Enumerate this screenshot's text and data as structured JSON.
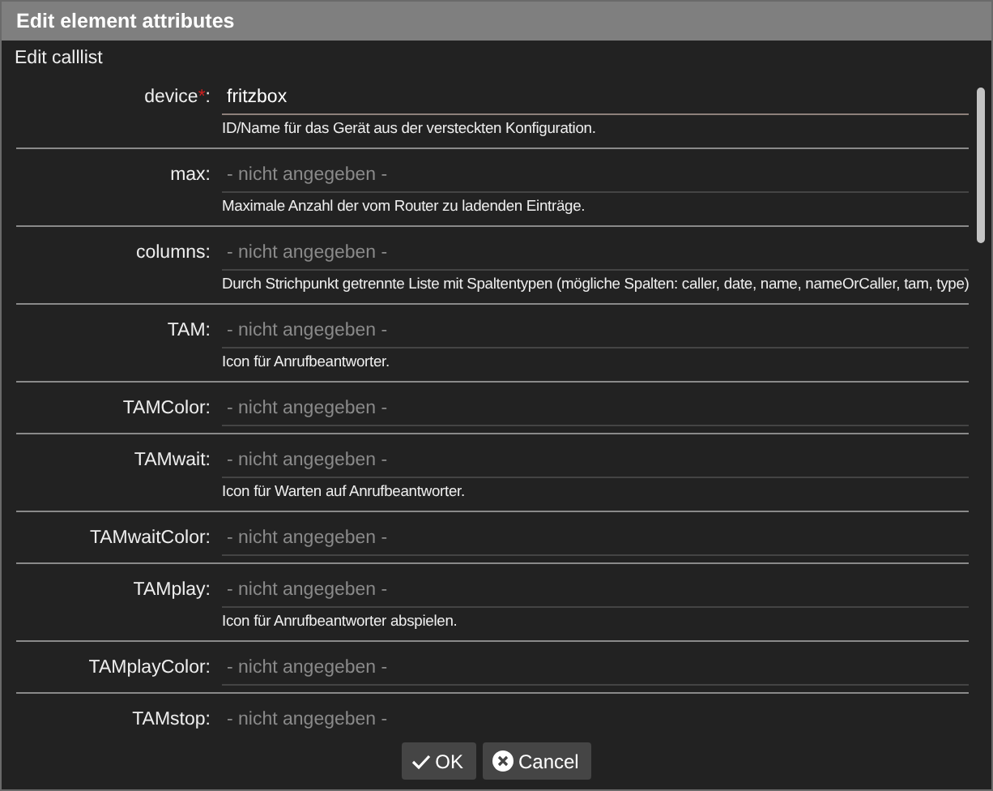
{
  "window": {
    "title": "Edit element attributes"
  },
  "section_title": "Edit calllist",
  "fields": [
    {
      "label": "device",
      "required_mark": "*",
      "label_suffix": ":",
      "value": "fritzbox",
      "focused": true,
      "description": "ID/Name für das Gerät aus der versteckten Konfiguration."
    },
    {
      "label": "max:",
      "placeholder": "- nicht angegeben -",
      "focused": false,
      "description": "Maximale Anzahl der vom Router zu ladenden Einträge."
    },
    {
      "label": "columns:",
      "placeholder": "- nicht angegeben -",
      "focused": false,
      "description": "Durch Strichpunkt getrennte Liste mit Spaltentypen (mögliche Spalten: caller, date, name, nameOrCaller, tam, type)"
    },
    {
      "label": "TAM:",
      "placeholder": "- nicht angegeben -",
      "focused": false,
      "description": "Icon für Anrufbeantworter."
    },
    {
      "label": "TAMColor:",
      "placeholder": "- nicht angegeben -",
      "focused": false
    },
    {
      "label": "TAMwait:",
      "placeholder": "- nicht angegeben -",
      "focused": false,
      "description": "Icon für Warten auf Anrufbeantworter."
    },
    {
      "label": "TAMwaitColor:",
      "placeholder": "- nicht angegeben -",
      "focused": false
    },
    {
      "label": "TAMplay:",
      "placeholder": "- nicht angegeben -",
      "focused": false,
      "description": "Icon für Anrufbeantworter abspielen."
    },
    {
      "label": "TAMplayColor:",
      "placeholder": "- nicht angegeben -",
      "focused": false
    },
    {
      "label": "TAMstop:",
      "placeholder": "- nicht angegeben -"
    }
  ],
  "buttons": [
    {
      "label": "OK",
      "kind": "ok"
    },
    {
      "label": "Cancel",
      "kind": "cancel"
    }
  ]
}
